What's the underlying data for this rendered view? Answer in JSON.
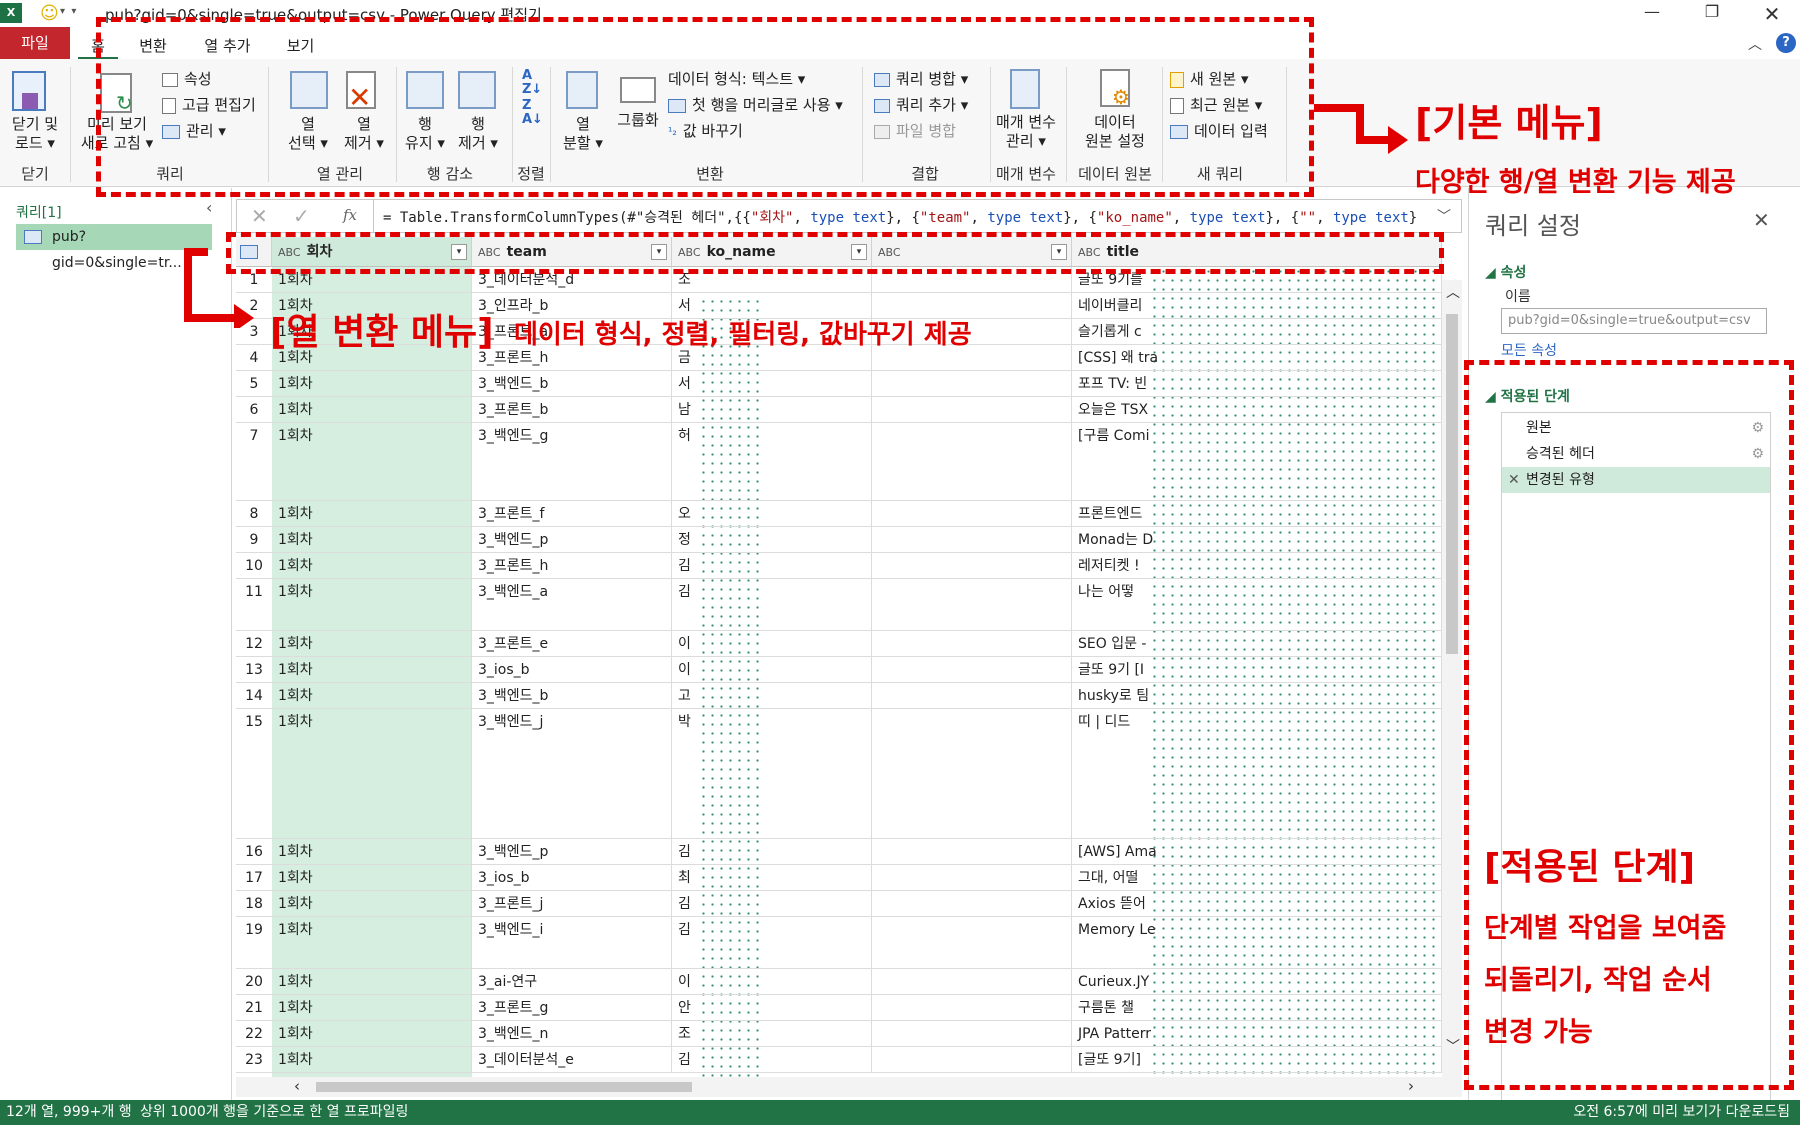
{
  "window": {
    "title": "pub?gid=0&single=true&output=csv - Power Query 편집기",
    "app_icon": "excel-icon"
  },
  "tabs": {
    "file": "파일",
    "home": "홈",
    "transform": "변환",
    "add_column": "열 추가",
    "view": "보기"
  },
  "ribbon": {
    "close_load": [
      "닫기 및",
      "로드"
    ],
    "refresh_preview": [
      "미리 보기",
      "새로 고침"
    ],
    "properties": "속성",
    "advanced_editor": "고급 편집기",
    "manage": "관리",
    "choose_columns": [
      "열",
      "선택"
    ],
    "remove_columns": [
      "열",
      "제거"
    ],
    "keep_rows": [
      "행",
      "유지"
    ],
    "remove_rows": [
      "행",
      "제거"
    ],
    "split_column": [
      "열",
      "분할"
    ],
    "group_by": "그룹화",
    "data_type": "데이터 형식: 텍스트",
    "first_row_header": "첫 행을 머리글로 사용",
    "replace_values": "값 바꾸기",
    "merge_queries": "쿼리 병합",
    "append_queries": "쿼리 추가",
    "combine_files": "파일 병합",
    "manage_params": [
      "매개 변수",
      "관리"
    ],
    "data_source_settings": [
      "데이터",
      "원본 설정"
    ],
    "new_source": "새 원본",
    "recent_sources": "최근 원본",
    "enter_data": "데이터 입력",
    "groups": {
      "close": "닫기",
      "query": "쿼리",
      "manage_columns": "열 관리",
      "reduce_rows": "행 감소",
      "sort": "정렬",
      "transform": "변환",
      "combine": "결합",
      "parameters": "매개 변수",
      "data_sources": "데이터 원본",
      "new_query": "새 쿼리"
    }
  },
  "queries_pane": {
    "header": "쿼리[1]",
    "item": "pub?gid=0&single=tr..."
  },
  "formula": {
    "fx": "fx",
    "p1": "= Table.TransformColumnTypes(#\"승격된 헤더\",{{",
    "s1": "\"회차\"",
    "p2": ", ",
    "k1": "type text",
    "p3": "}, {",
    "s2": "\"team\"",
    "p4": ", ",
    "k2": "type text",
    "p5": "}, {",
    "s3": "\"ko_name\"",
    "p6": ", ",
    "k3": "type text",
    "p7": "}, {",
    "s4": "\"\"",
    "p8": ", ",
    "k4": "type text",
    "p9": "}"
  },
  "grid": {
    "type_label": "ABC",
    "columns": [
      "회차",
      "team",
      "ko_name",
      "",
      "title"
    ],
    "rows": [
      {
        "n": "1",
        "a": "1회차",
        "b": "3_데이터분석_d",
        "c": "조",
        "e": "글또 9기를"
      },
      {
        "n": "2",
        "a": "1회차",
        "b": "3_인프라_b",
        "c": "서",
        "e": "네이버클리"
      },
      {
        "n": "3",
        "a": "1회차",
        "b": "3_프론트_a",
        "c": "",
        "e": "슬기롭게 c"
      },
      {
        "n": "4",
        "a": "1회차",
        "b": "3_프론트_h",
        "c": "금",
        "e": "[CSS] 왜 tra"
      },
      {
        "n": "5",
        "a": "1회차",
        "b": "3_백엔드_b",
        "c": "서",
        "e": "포프 TV: 빈"
      },
      {
        "n": "6",
        "a": "1회차",
        "b": "3_프론트_b",
        "c": "남",
        "e": "오늘은 TSX"
      },
      {
        "n": "7",
        "a": "1회차",
        "b": "3_백엔드_g",
        "c": "허",
        "e": "[구름 Comi"
      },
      {
        "n": "8",
        "a": "1회차",
        "b": "3_프론트_f",
        "c": "오",
        "e": "프론트엔드"
      },
      {
        "n": "9",
        "a": "1회차",
        "b": "3_백엔드_p",
        "c": "정",
        "e": "Monad는 D"
      },
      {
        "n": "10",
        "a": "1회차",
        "b": "3_프론트_h",
        "c": "김",
        "e": "레저티켓 !"
      },
      {
        "n": "11",
        "a": "1회차",
        "b": "3_백엔드_a",
        "c": "김",
        "e": "나는 어떻"
      },
      {
        "n": "12",
        "a": "1회차",
        "b": "3_프론트_e",
        "c": "이",
        "e": "SEO 입문 -"
      },
      {
        "n": "13",
        "a": "1회차",
        "b": "3_ios_b",
        "c": "이",
        "e": "글또 9기 [I"
      },
      {
        "n": "14",
        "a": "1회차",
        "b": "3_백엔드_b",
        "c": "고",
        "e": "husky로 팀"
      },
      {
        "n": "15",
        "a": "1회차",
        "b": "3_백엔드_j",
        "c": "박",
        "e": "띠 | 디드"
      },
      {
        "n": "16",
        "a": "1회차",
        "b": "3_백엔드_p",
        "c": "김",
        "e": "[AWS] Ama"
      },
      {
        "n": "17",
        "a": "1회차",
        "b": "3_ios_b",
        "c": "최",
        "e": "그대, 어떨"
      },
      {
        "n": "18",
        "a": "1회차",
        "b": "3_프론트_j",
        "c": "김",
        "e": "Axios 뜯어"
      },
      {
        "n": "19",
        "a": "1회차",
        "b": "3_백엔드_i",
        "c": "김",
        "e": "Memory Le"
      },
      {
        "n": "20",
        "a": "1회차",
        "b": "3_ai-연구",
        "c": "이",
        "e": "Curieux.JY"
      },
      {
        "n": "21",
        "a": "1회차",
        "b": "3_프론트_g",
        "c": "안",
        "e": "구름톤 챌"
      },
      {
        "n": "22",
        "a": "1회차",
        "b": "3_백엔드_n",
        "c": "조",
        "e": "JPA Patterr"
      },
      {
        "n": "23",
        "a": "1회차",
        "b": "3_데이터분석_e",
        "c": "김",
        "e": "[글또 9기]"
      }
    ]
  },
  "settings": {
    "title": "쿼리 설정",
    "properties": "속성",
    "name_label": "이름",
    "name_value": "pub?gid=0&single=true&output=csv",
    "all_properties": "모든 속성",
    "applied_steps": "적용된 단계",
    "steps": [
      "원본",
      "승격된 헤더",
      "변경된 유형"
    ]
  },
  "status": {
    "left1": "12개 열, 999+개 행",
    "left2": "상위 1000개 행을 기준으로 한 열 프로파일링",
    "right": "오전 6:57에 미리 보기가 다운로드됨"
  },
  "annotations": {
    "basic_menu_title": "[기본 메뉴]",
    "basic_menu_desc": "다양한 행/열 변환 기능 제공",
    "col_menu_title": "[열 변환 메뉴]",
    "col_menu_desc": "데이터 형식, 정렬, 필터링, 값바꾸기 제공",
    "steps_title": "[적용된 단계]",
    "steps_line1": "단계별 작업을 보여줌",
    "steps_line2": "되돌리기, 작업 순서",
    "steps_line3": "변경 가능"
  },
  "colors": {
    "accent_red": "#e00000",
    "excel_green": "#217346",
    "selected_column": "#d6eedf",
    "file_tab": "#c4262e"
  }
}
